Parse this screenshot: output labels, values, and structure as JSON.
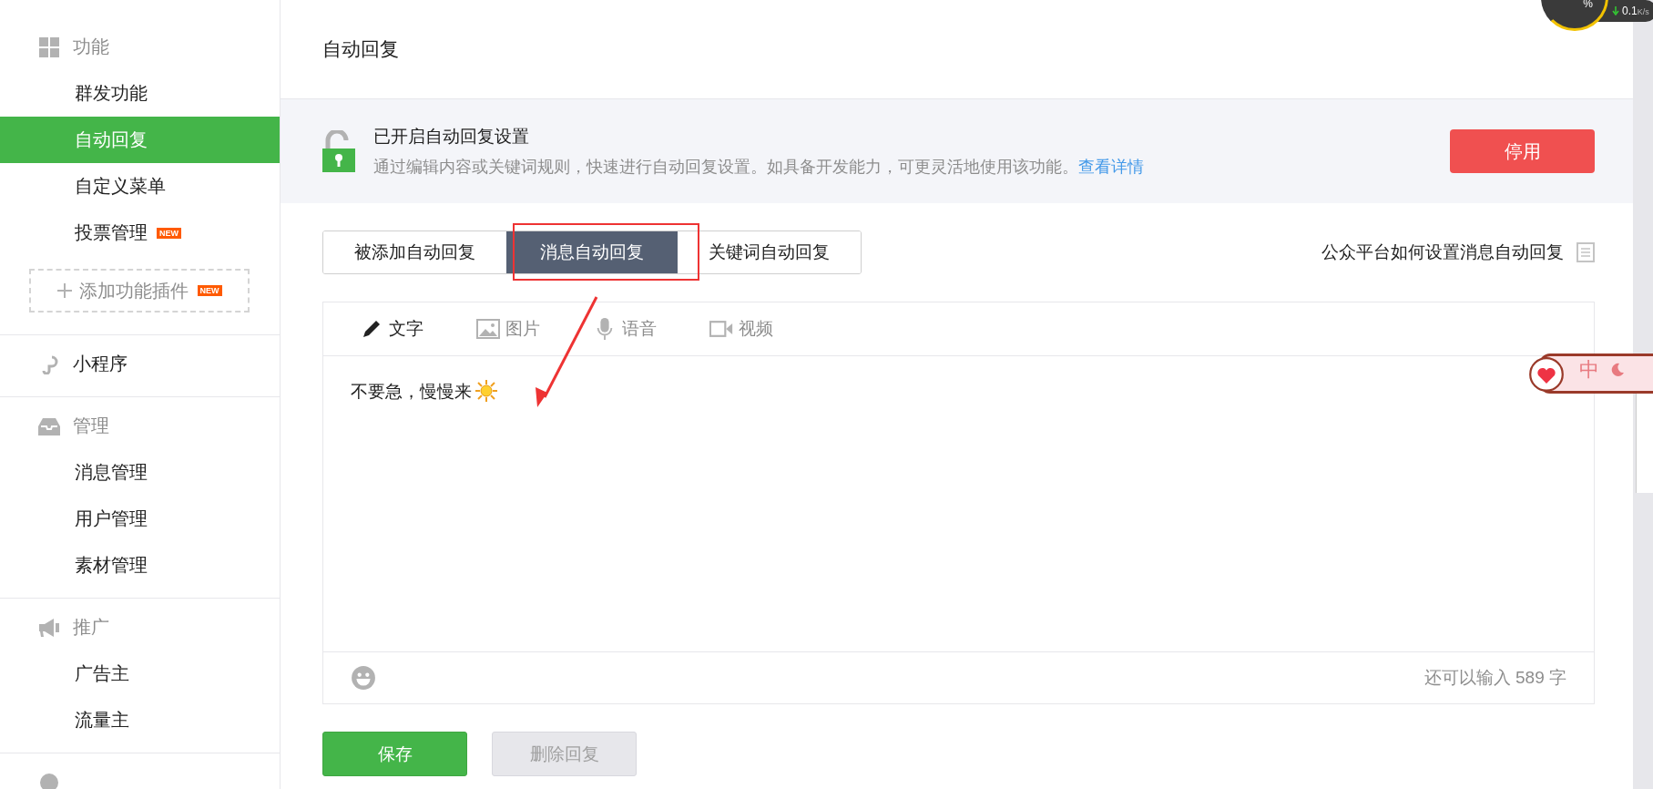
{
  "sidebar": {
    "sections": [
      {
        "heading": "功能",
        "kind": "features",
        "items": [
          {
            "label": "群发功能",
            "selected": false
          },
          {
            "label": "自动回复",
            "selected": true
          },
          {
            "label": "自定义菜单",
            "selected": false
          },
          {
            "label": "投票管理",
            "selected": false,
            "badge": "NEW"
          }
        ],
        "add_plugin": {
          "label": "添加功能插件",
          "badge": "NEW"
        }
      },
      {
        "heading": "小程序",
        "kind": "miniprogram"
      },
      {
        "heading": "管理",
        "kind": "management",
        "items": [
          {
            "label": "消息管理",
            "selected": false
          },
          {
            "label": "用户管理",
            "selected": false
          },
          {
            "label": "素材管理",
            "selected": false
          }
        ]
      },
      {
        "heading": "推广",
        "kind": "promotion",
        "items": [
          {
            "label": "广告主",
            "selected": false
          },
          {
            "label": "流量主",
            "selected": false
          }
        ]
      },
      {
        "kind": "statistics"
      }
    ]
  },
  "page_title": "自动回复",
  "banner": {
    "title": "已开启自动回复设置",
    "description": "通过编辑内容或关键词规则，快速进行自动回复设置。如具备开发能力，可更灵活地使用该功能。",
    "link": "查看详情",
    "button": "停用"
  },
  "tabs": [
    {
      "label": "被添加自动回复",
      "selected": false
    },
    {
      "label": "消息自动回复",
      "selected": true
    },
    {
      "label": "关键词自动回复",
      "selected": false
    }
  ],
  "help_link": "公众平台如何设置消息自动回复",
  "editor": {
    "media_tabs": [
      {
        "label": "文字",
        "kind": "text",
        "selected": true
      },
      {
        "label": "图片",
        "kind": "image",
        "selected": false
      },
      {
        "label": "语音",
        "kind": "voice",
        "selected": false
      },
      {
        "label": "视频",
        "kind": "video",
        "selected": false
      }
    ],
    "content": "不要急，慢慢来",
    "counter": "还可以输入 589 字"
  },
  "buttons": [
    {
      "label": "保存",
      "disabled": false
    },
    {
      "label": "删除回复",
      "disabled": true
    }
  ],
  "net_monitor": {
    "percent_sign": "%",
    "speed": "0.1",
    "unit": "K/s"
  },
  "ime_toolbar": {
    "mode": "中"
  }
}
